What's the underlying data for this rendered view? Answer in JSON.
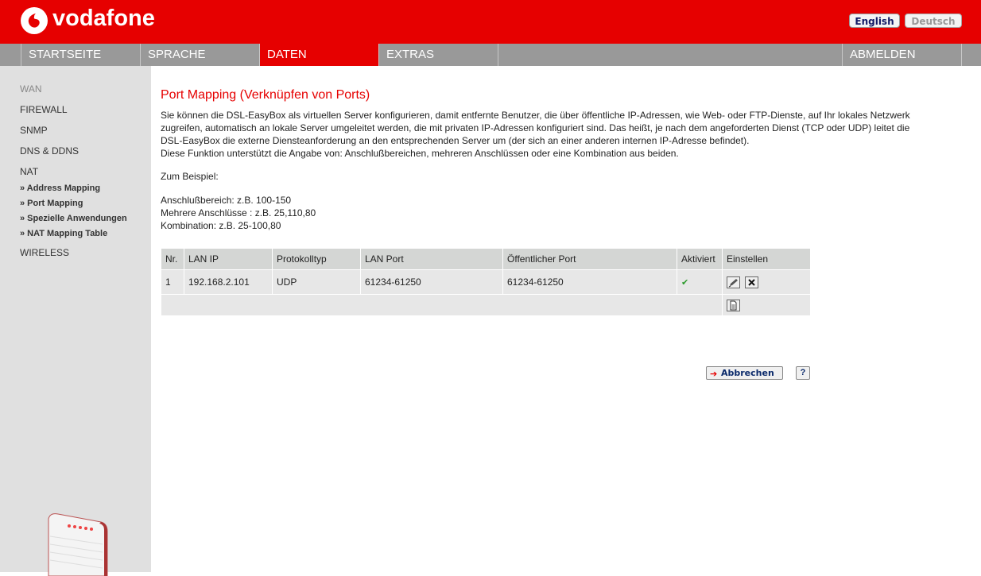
{
  "header": {
    "brand": "vodafone",
    "lang_en": "English",
    "lang_de": "Deutsch",
    "brand_color": "#e60000"
  },
  "nav": {
    "items": [
      "STARTSEITE",
      "SPRACHE",
      "DATEN",
      "EXTRAS"
    ],
    "active": "DATEN",
    "logout": "ABMELDEN"
  },
  "sidebar": {
    "wan": "WAN",
    "firewall": "FIREWALL",
    "snmp": "SNMP",
    "dns": "DNS & DDNS",
    "nat": "NAT",
    "sub": [
      "» Address Mapping",
      "» Port Mapping",
      "» Spezielle Anwendungen",
      "» NAT Mapping Table"
    ],
    "wireless": "WIRELESS"
  },
  "main": {
    "title": "Port Mapping (Verknüpfen von Ports)",
    "intro_lines": [
      "Sie können die DSL-EasyBox als virtuellen Server konfigurieren, damit entfernte Benutzer, die über öffentliche IP-Adressen, wie Web- oder FTP-Dienste, auf Ihr lokales Netzwerk",
      "zugreifen, automatisch an lokale Server umgeleitet werden, die mit privaten IP-Adressen konfiguriert sind. Das heißt, je nach dem angeforderten Dienst (TCP oder UDP) leitet die",
      "DSL-EasyBox die externe Diensteanforderung an den entsprechenden Server um (der sich an einer anderen internen IP-Adresse befindet).",
      "Diese Funktion unterstützt die Angabe von: Anschlußbereichen, mehreren Anschlüssen oder eine Kombination aus beiden."
    ],
    "example_label": "Zum Beispiel:",
    "examples": [
      "Anschlußbereich: z.B. 100-150",
      "Mehrere Anschlüsse : z.B. 25,110,80",
      "Kombination: z.B. 25-100,80"
    ],
    "table": {
      "headers": [
        "Nr.",
        "LAN IP",
        "Protokolltyp",
        "LAN Port",
        "Öffentlicher Port",
        "Aktiviert",
        "Einstellen"
      ],
      "rows": [
        {
          "nr": "1",
          "lan_ip": "192.168.2.101",
          "protocol": "UDP",
          "lan_port": "61234-61250",
          "public_port": "61234-61250",
          "enabled": "✔"
        }
      ]
    },
    "cancel_label": "Abbrechen",
    "help_label": "?"
  }
}
